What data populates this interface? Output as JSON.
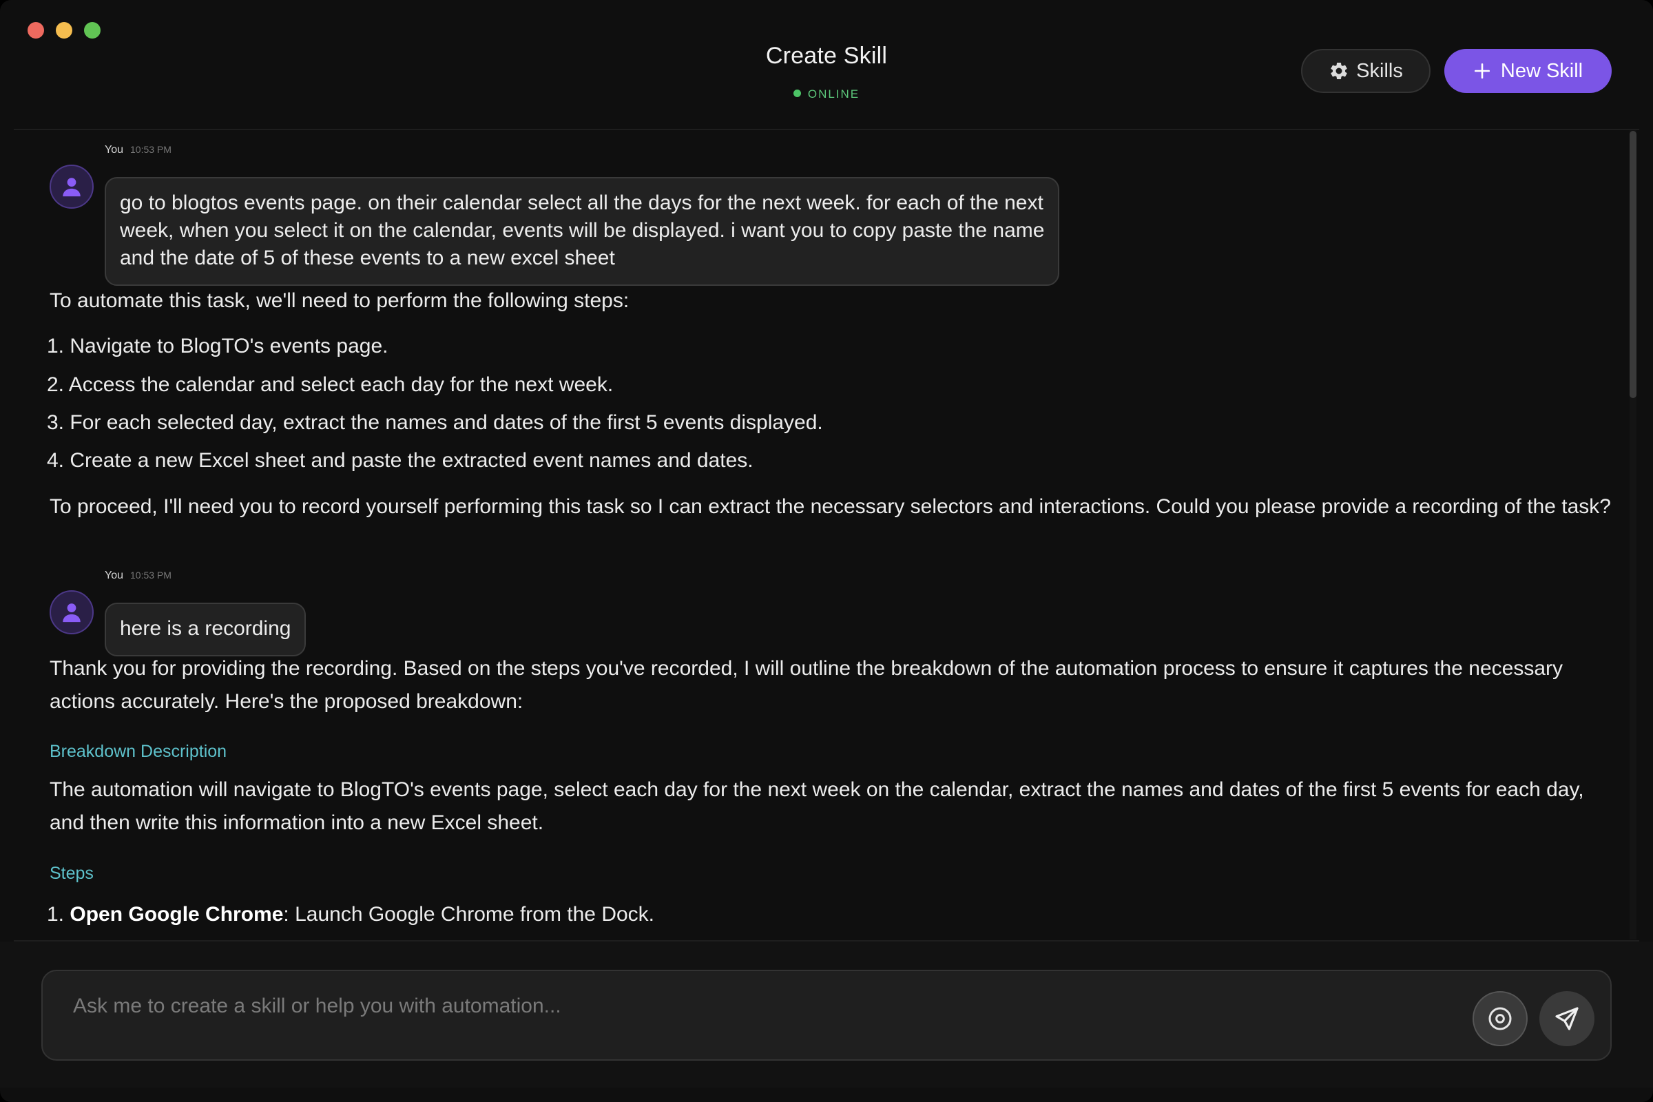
{
  "header": {
    "title": "Create Skill",
    "status": "ONLINE",
    "skills_label": "Skills",
    "new_skill_label": "New Skill"
  },
  "messages": {
    "user1": {
      "author": "You",
      "time": "10:53 PM",
      "lines": [
        "go to blogtos events page. on their calendar select all the days for the next week. for each of the next",
        "week, when you select it on the calendar, events will be displayed. i want you to copy paste the name",
        "and the date of 5 of these events to a new excel sheet"
      ]
    },
    "ai1": {
      "intro": "To automate this task, we'll need to perform the following steps:",
      "steps": [
        "1. Navigate to BlogTO's events page.",
        "2. Access the calendar and select each day for the next week.",
        "3. For each selected day, extract the names and dates of the first 5 events displayed.",
        "4. Create a new Excel sheet and paste the extracted event names and dates."
      ],
      "outro": "To proceed, I'll need you to record yourself performing this task so I can extract the necessary selectors and interactions. Could you please provide a recording of the task?"
    },
    "user2": {
      "author": "You",
      "time": "10:53 PM",
      "text": "here is a recording"
    },
    "ai2": {
      "intro": "Thank you for providing the recording. Based on the steps you've recorded, I will outline the breakdown of the automation process to ensure it captures the necessary actions accurately. Here's the proposed breakdown:",
      "breakdown_heading": "Breakdown Description",
      "breakdown_text": "The automation will navigate to BlogTO's events page, select each day for the next week on the calendar, extract the names and dates of the first 5 events for each day, and then write this information into a new Excel sheet.",
      "steps_heading": "Steps",
      "step1_number": "1.",
      "step1_bold": "Open Google Chrome",
      "step1_rest": ": Launch Google Chrome from the Dock."
    }
  },
  "composer": {
    "placeholder": "Ask me to create a skill or help you with automation..."
  },
  "colors": {
    "accent": "#7b55e6",
    "online": "#4cc466",
    "section_heading": "#5ec2cc"
  },
  "icons": {
    "skills": "gear-icon",
    "new_skill": "plus-icon",
    "avatar": "user-icon",
    "record": "record-icon",
    "send": "send-icon"
  }
}
